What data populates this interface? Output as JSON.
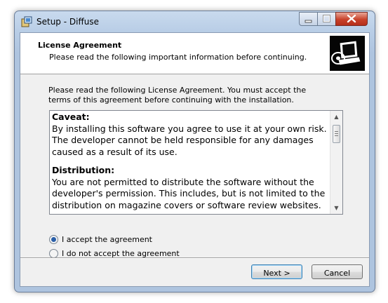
{
  "window": {
    "title": "Setup - Diffuse"
  },
  "header": {
    "title": "License Agreement",
    "subtitle": "Please read the following important information before continuing."
  },
  "intro": "Please read the following License Agreement. You must accept the terms of this agreement before continuing with the installation.",
  "license": {
    "caveat_heading": "Caveat:",
    "caveat_text": "By installing this software you agree to use it at your own risk. The developer cannot be held responsible for any damages caused as a result of its use.",
    "distribution_heading": "Distribution:",
    "distribution_text": "You are not permitted to distribute the software without the developer's permission. This includes, but is not limited to the distribution on magazine covers or software review websites."
  },
  "options": {
    "accept": {
      "label": "I accept the agreement",
      "selected": true
    },
    "decline": {
      "label": "I do not accept the agreement",
      "selected": false
    }
  },
  "buttons": {
    "next": "Next >",
    "cancel": "Cancel"
  },
  "icons": {
    "app": "setup-icon",
    "wizard": "computer-disk-icon",
    "minimize": "minimize-icon",
    "maximize": "maximize-icon",
    "close": "close-icon"
  }
}
